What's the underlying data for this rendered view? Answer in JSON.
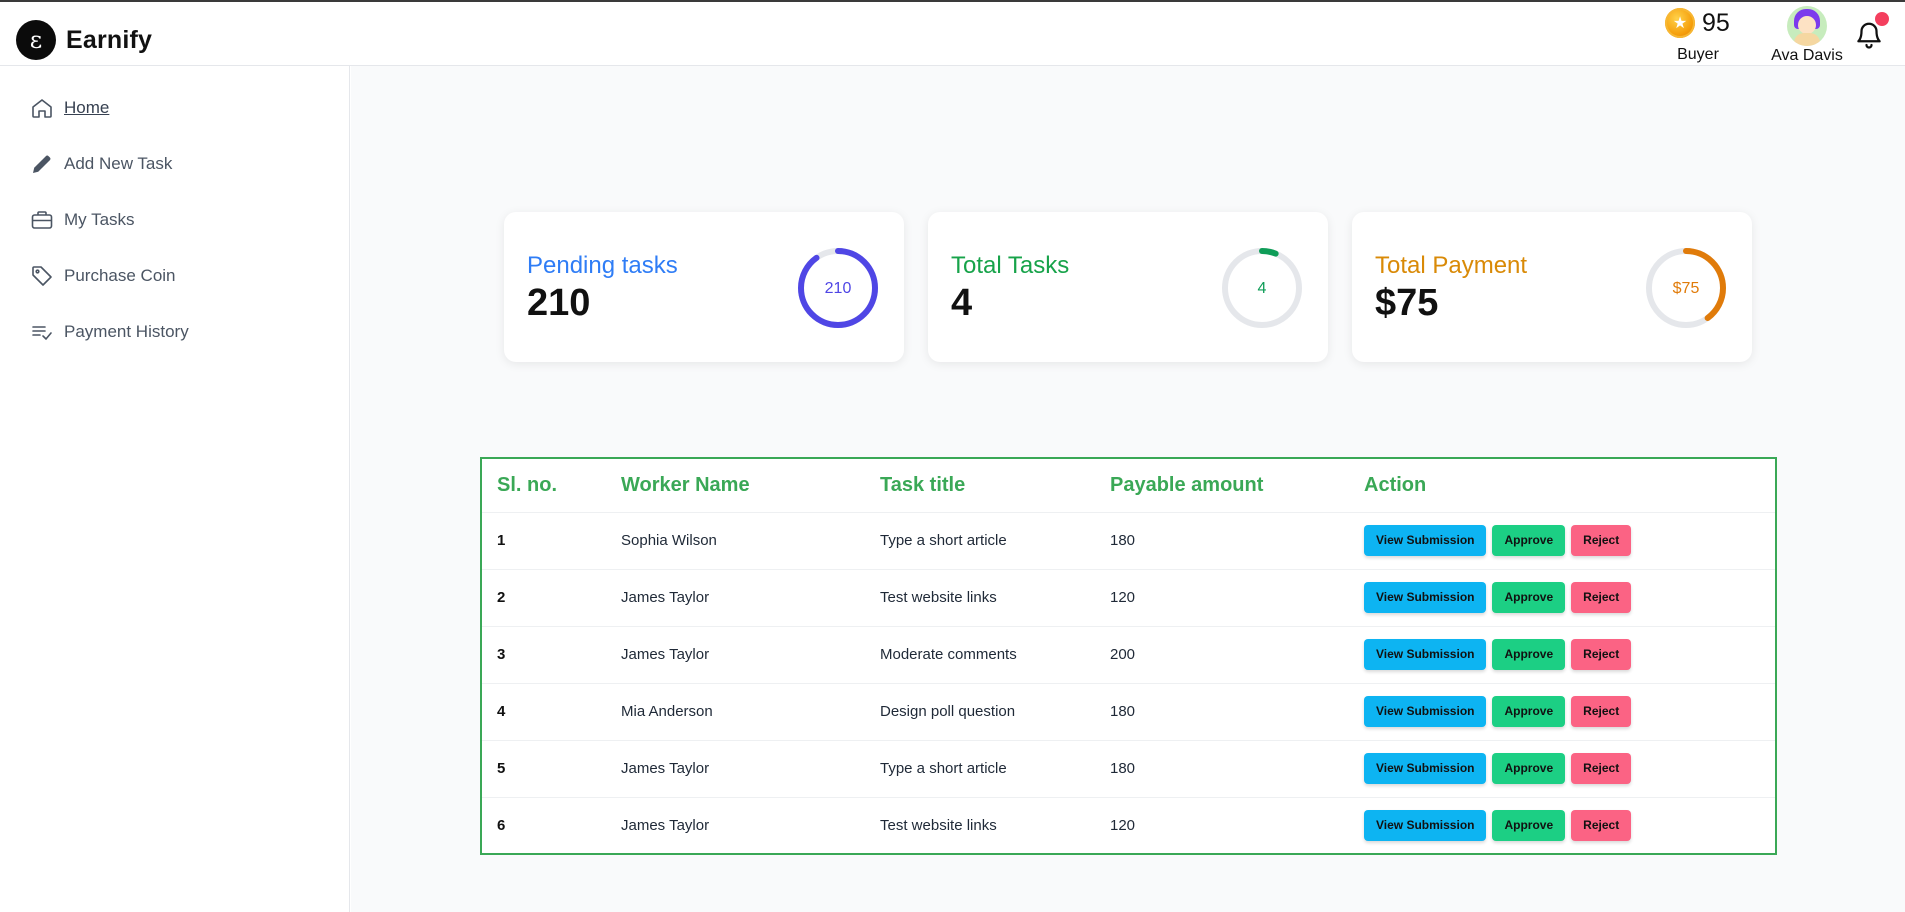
{
  "brand": {
    "logo_letter": "ε",
    "name": "Earnify"
  },
  "header": {
    "coins": "95",
    "role": "Buyer",
    "user_name": "Ava Davis",
    "coin_icon": "star-coin-icon",
    "bell_icon": "bell-icon"
  },
  "sidebar": {
    "items": [
      {
        "label": "Home",
        "icon": "home-icon",
        "active": true
      },
      {
        "label": "Add New Task",
        "icon": "pencil-icon"
      },
      {
        "label": "My Tasks",
        "icon": "briefcase-icon"
      },
      {
        "label": "Purchase Coin",
        "icon": "tag-icon"
      },
      {
        "label": "Payment History",
        "icon": "list-check-icon"
      }
    ]
  },
  "stats": [
    {
      "title": "Pending tasks",
      "value": "210",
      "ring_label": "210",
      "progress": 0.9,
      "color": "#2f7df6",
      "ring_color": "#4f46e5"
    },
    {
      "title": "Total Tasks",
      "value": "4",
      "ring_label": "4",
      "progress": 0.06,
      "color": "#17a34a",
      "ring_color": "#0f9d58"
    },
    {
      "title": "Total Payment",
      "value": "$75",
      "ring_label": "$75",
      "progress": 0.4,
      "color": "#d98a07",
      "ring_color": "#e07b0a"
    }
  ],
  "table": {
    "headers": [
      "Sl. no.",
      "Worker Name",
      "Task title",
      "Payable amount",
      "Action"
    ],
    "buttons": {
      "view": "View Submission",
      "approve": "Approve",
      "reject": "Reject"
    },
    "rows": [
      {
        "sl": "1",
        "worker": "Sophia Wilson",
        "task": "Type a short article",
        "amount": "180"
      },
      {
        "sl": "2",
        "worker": "James Taylor",
        "task": "Test website links",
        "amount": "120"
      },
      {
        "sl": "3",
        "worker": "James Taylor",
        "task": "Moderate comments",
        "amount": "200"
      },
      {
        "sl": "4",
        "worker": "Mia Anderson",
        "task": "Design poll question",
        "amount": "180"
      },
      {
        "sl": "5",
        "worker": "James Taylor",
        "task": "Type a short article",
        "amount": "180"
      },
      {
        "sl": "6",
        "worker": "James Taylor",
        "task": "Test website links",
        "amount": "120"
      }
    ]
  },
  "colors": {
    "accent_green": "#3aa856",
    "view": "#0db4f2",
    "approve": "#1ccf84",
    "reject": "#fb6384"
  }
}
